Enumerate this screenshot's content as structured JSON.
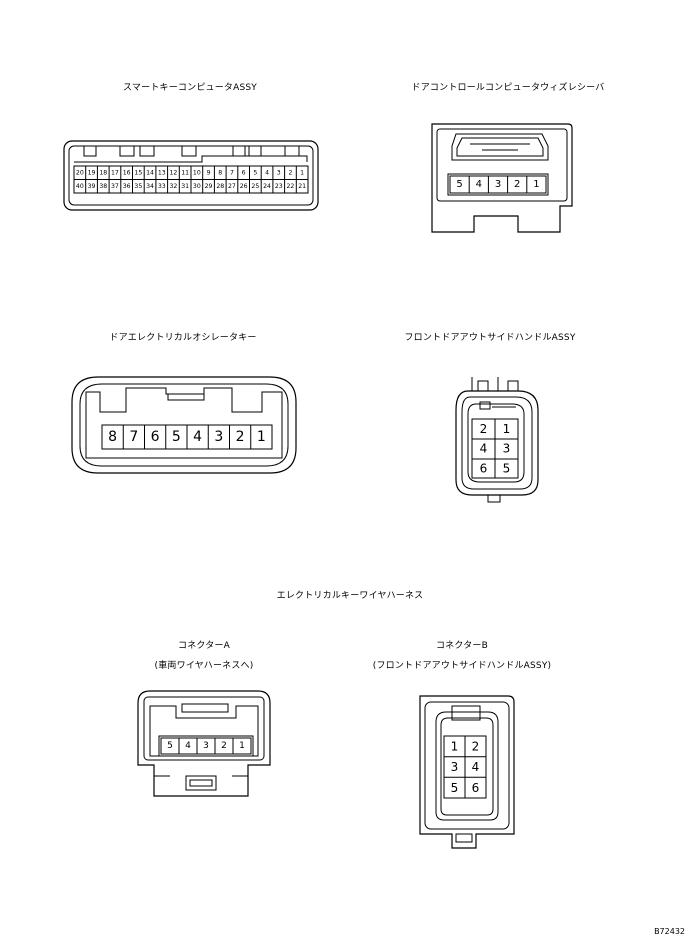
{
  "titles": {
    "smart_key": "スマートキーコンピュータASSY",
    "door_control": "ドアコントロールコンピュータウィズレシーバ",
    "oscillator": "ドアエレクトリカルオシレータキー",
    "handle": "フロントドアアウトサイドハンドルASSY",
    "harness": "エレクトリカルキーワイヤハーネス",
    "conn_a": "コネクターA",
    "conn_a_sub": "(車両ワイヤハーネスへ)",
    "conn_b": "コネクターB",
    "conn_b_sub": "(フロントドアアウトサイドハンドルASSY)"
  },
  "smart_key_pins_top": [
    "20",
    "19",
    "18",
    "17",
    "16",
    "15",
    "14",
    "13",
    "12",
    "11",
    "10",
    "9",
    "8",
    "7",
    "6",
    "5",
    "4",
    "3",
    "2",
    "1"
  ],
  "smart_key_pins_bottom": [
    "40",
    "39",
    "38",
    "37",
    "36",
    "35",
    "34",
    "33",
    "32",
    "31",
    "30",
    "29",
    "28",
    "27",
    "26",
    "25",
    "24",
    "23",
    "22",
    "21"
  ],
  "door_control_pins": [
    "5",
    "4",
    "3",
    "2",
    "1"
  ],
  "oscillator_pins": [
    "8",
    "7",
    "6",
    "5",
    "4",
    "3",
    "2",
    "1"
  ],
  "handle_pins": [
    [
      "2",
      "1"
    ],
    [
      "4",
      "3"
    ],
    [
      "6",
      "5"
    ]
  ],
  "conn_a_pins": [
    "5",
    "4",
    "3",
    "2",
    "1"
  ],
  "conn_b_pins": [
    [
      "1",
      "2"
    ],
    [
      "3",
      "4"
    ],
    [
      "5",
      "6"
    ]
  ],
  "figure_id": "B72432"
}
